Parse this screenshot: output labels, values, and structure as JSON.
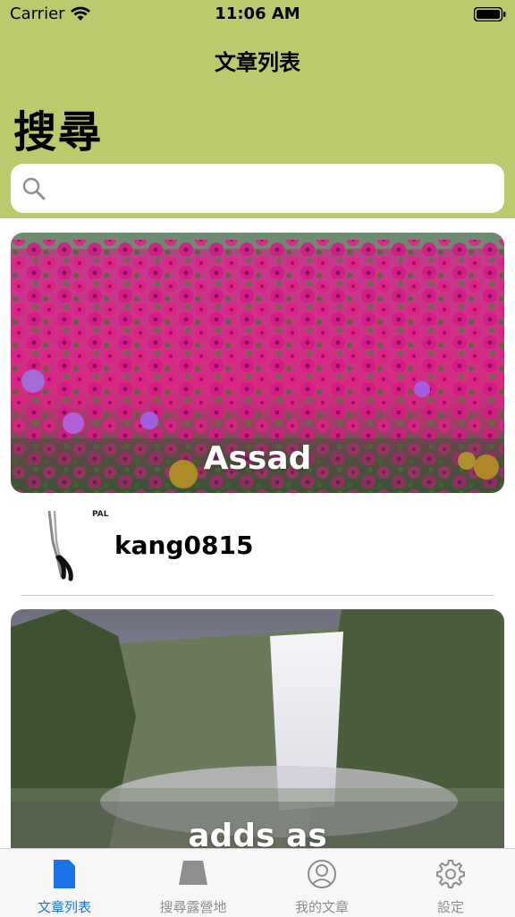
{
  "status_bar": {
    "carrier": "Carrier",
    "time": "11:06 AM"
  },
  "nav": {
    "title": "文章列表",
    "large_title": "搜尋"
  },
  "search": {
    "placeholder": "",
    "value": ""
  },
  "cards": [
    {
      "caption": "Assad",
      "image": "pink-flower-field"
    },
    {
      "caption": "adds as",
      "image": "waterfall-landscape"
    }
  ],
  "author_row": {
    "name": "kang0815",
    "thumbnail": "pliers-image",
    "thumb_text": "PAL"
  },
  "tab_bar": {
    "active": "tab-article-list",
    "tabs": [
      {
        "label": "文章列表",
        "icon": "document-icon"
      },
      {
        "label": "搜尋露營地",
        "icon": "map-icon"
      },
      {
        "label": "我的文章",
        "icon": "person-icon"
      },
      {
        "label": "設定",
        "icon": "gear-icon"
      }
    ]
  },
  "colors": {
    "header": "#bcc96c",
    "accent": "#1a74e8",
    "tab_inactive": "#8e8e8e"
  }
}
